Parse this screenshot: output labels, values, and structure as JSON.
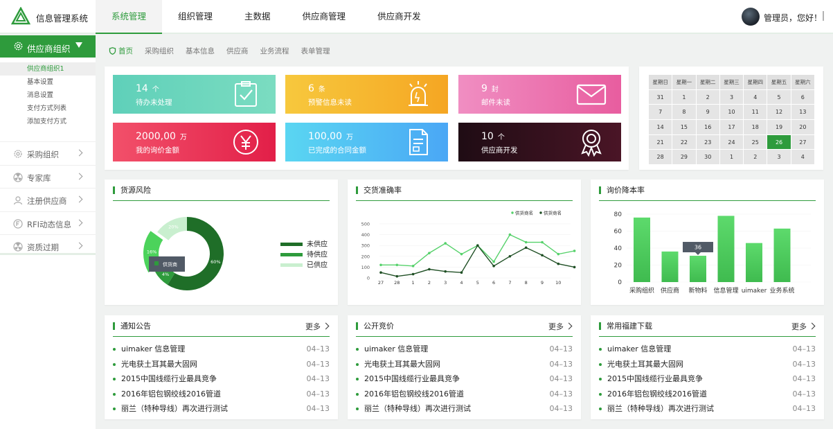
{
  "app": {
    "title": "信息管理系统",
    "logo_icon": "triangle-logo-icon"
  },
  "topnav": [
    {
      "label": "系统管理",
      "active": true
    },
    {
      "label": "组织管理",
      "active": false
    },
    {
      "label": "主数据",
      "active": false
    },
    {
      "label": "供应商管理",
      "active": false
    },
    {
      "label": "供应商开发",
      "active": false
    }
  ],
  "user": {
    "greeting": "管理员，您好！",
    "avatar_icon": "avatar-photo",
    "power_icon": "power-icon"
  },
  "sidebar": {
    "header": {
      "label": "供应商组织",
      "icon": "gear-icon"
    },
    "sub_items": [
      "供应商组织1",
      "基本设置",
      "消息设置",
      "支付方式列表",
      "添加支付方式"
    ],
    "active_sub": 0,
    "items": [
      {
        "label": "采购组织",
        "icon": "gear-icon"
      },
      {
        "label": "专家库",
        "icon": "radiation-icon"
      },
      {
        "label": "注册供应商",
        "icon": "user-icon"
      },
      {
        "label": "RFI动态信息",
        "icon": "rfi-icon"
      },
      {
        "label": "资质过期",
        "icon": "radiation-icon"
      }
    ]
  },
  "breadcrumb": [
    "首页",
    "采购组织",
    "基本信息",
    "供应商",
    "业务流程",
    "表单管理"
  ],
  "stats": [
    {
      "value": "14",
      "unit": "个",
      "desc": "待办未处理",
      "icon": "clipboard-check-icon",
      "color_from": "#5fd0b9",
      "color_to": "#7bdcc1"
    },
    {
      "value": "6",
      "unit": "条",
      "desc": "预警信息未读",
      "icon": "alarm-light-icon",
      "color_from": "#f7c83d",
      "color_to": "#f5a623"
    },
    {
      "value": "9",
      "unit": "封",
      "desc": "邮件未读",
      "icon": "envelope-icon",
      "color_from": "#f08ec2",
      "color_to": "#e85d9f"
    },
    {
      "value": "2000,00",
      "unit": "万",
      "desc": "我的询价金额",
      "icon": "yuan-circle-icon",
      "color_from": "#f2506a",
      "color_to": "#e21f48"
    },
    {
      "value": "100,00",
      "unit": "万",
      "desc": "已完成的合同金额",
      "icon": "document-icon",
      "color_from": "#5ad6f2",
      "color_to": "#4aa7f5"
    },
    {
      "value": "10",
      "unit": "个",
      "desc": "供应商开发",
      "icon": "award-ribbon-icon",
      "color_from": "#1f0c14",
      "color_to": "#4a1526"
    }
  ],
  "calendar": {
    "weekdays": [
      "星期日",
      "星期一",
      "星期二",
      "星期三",
      "星期四",
      "星期五",
      "星期六"
    ],
    "weeks": [
      [
        "31",
        "1",
        "2",
        "3",
        "4",
        "5",
        "6"
      ],
      [
        "7",
        "8",
        "9",
        "10",
        "11",
        "12",
        "13"
      ],
      [
        "14",
        "15",
        "16",
        "17",
        "18",
        "19",
        "20"
      ],
      [
        "21",
        "22",
        "23",
        "24",
        "25",
        "26",
        "27"
      ],
      [
        "28",
        "29",
        "30",
        "1",
        "2",
        "3",
        "4"
      ]
    ],
    "today": "26"
  },
  "panels": {
    "supply_risk": "货源风险",
    "delivery_accuracy": "交货准确率",
    "price_reduction": "询价降本率",
    "notice": "通知公告",
    "bidding": "公开竞价",
    "downloads": "常用福建下载",
    "more": "更多"
  },
  "chart_data": [
    {
      "type": "pie",
      "title": "货源风险",
      "slices": [
        {
          "label": "未供应",
          "value": 60,
          "color": "#1f6e28"
        },
        {
          "label": "待供应",
          "value": 4,
          "color": "#2e9b3c"
        },
        {
          "label": "已供应",
          "value": 20,
          "color": "#c9efcf"
        },
        {
          "label": "",
          "value": 16,
          "color": "#4cd35b"
        }
      ],
      "slice_labels": [
        "60%",
        "4%",
        "20%",
        "16%"
      ],
      "tooltip": "供货商",
      "legend": [
        "未供应",
        "待供应",
        "已供应"
      ],
      "legend_position": "right"
    },
    {
      "type": "line",
      "title": "交货准确率",
      "categories": [
        "27",
        "28",
        "1",
        "2",
        "3",
        "4",
        "5",
        "6",
        "7",
        "8",
        "9",
        "10"
      ],
      "series": [
        {
          "name": "供货商名",
          "color": "#55d16a",
          "values": [
            120,
            120,
            110,
            230,
            320,
            220,
            300,
            150,
            400,
            330,
            330,
            220,
            250
          ]
        },
        {
          "name": "供货商名",
          "color": "#1f4f24",
          "values": [
            50,
            15,
            35,
            80,
            60,
            50,
            300,
            110,
            200,
            280,
            210,
            130,
            100
          ]
        }
      ],
      "yticks": [
        "500",
        "400",
        "300",
        "200",
        "100",
        "0"
      ],
      "ylim": [
        0,
        500
      ],
      "legend_position": "top-right"
    },
    {
      "type": "bar",
      "title": "询价降本率",
      "categories": [
        "采购组织",
        "供应商",
        "新物料",
        "信息管理",
        "uimaker",
        "业务系统"
      ],
      "values": [
        76,
        36,
        31,
        78,
        46,
        63
      ],
      "yticks": [
        "80",
        "60",
        "40",
        "20",
        "0"
      ],
      "ylim": [
        0,
        80
      ],
      "tooltip": "36"
    }
  ],
  "news": {
    "items": [
      {
        "title": "uimaker 信息管理",
        "date": "04–13"
      },
      {
        "title": "光电获土耳其最大固网",
        "date": "04–13"
      },
      {
        "title": "2015中国线缆行业最具竞争",
        "date": "04–13"
      },
      {
        "title": "2016年铝包钢绞线2016管道",
        "date": "04–13"
      },
      {
        "title": "丽兰（特种导线）再次进行测试",
        "date": "04–13"
      }
    ]
  }
}
